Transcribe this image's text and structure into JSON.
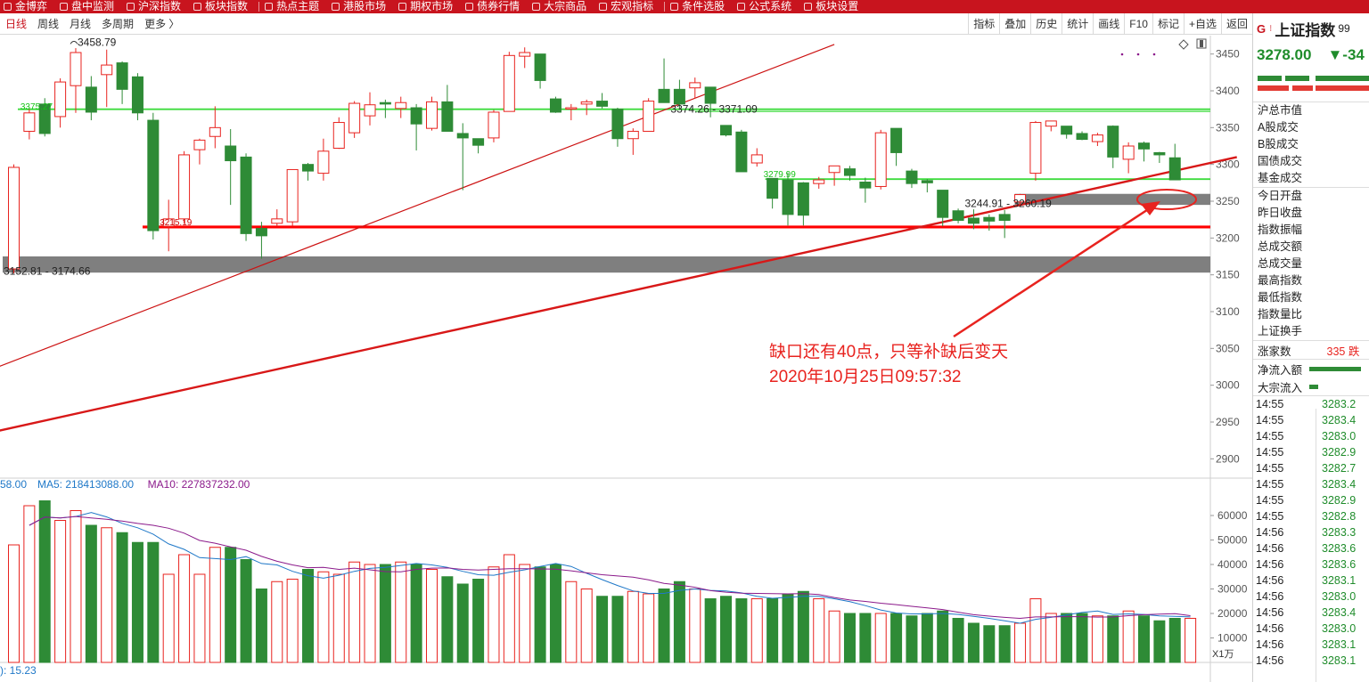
{
  "topbar": {
    "items": [
      {
        "label": "金博弈",
        "icon": "game-icon"
      },
      {
        "label": "盘中监测",
        "icon": "monitor-icon"
      },
      {
        "label": "沪深指数",
        "icon": "index-icon"
      },
      {
        "label": "板块指数",
        "icon": "sector-icon"
      },
      {
        "label": "热点主题",
        "icon": "hot-icon"
      },
      {
        "label": "港股市场",
        "icon": "hk-icon"
      },
      {
        "label": "期权市场",
        "icon": "option-icon"
      },
      {
        "label": "债券行情",
        "icon": "bond-icon"
      },
      {
        "label": "大宗商品",
        "icon": "commodity-icon"
      },
      {
        "label": "宏观指标",
        "icon": "macro-icon"
      },
      {
        "label": "条件选股",
        "icon": "filter-icon"
      },
      {
        "label": "公式系统",
        "icon": "formula-icon"
      },
      {
        "label": "板块设置",
        "icon": "settings-icon"
      }
    ]
  },
  "periods": [
    "日线",
    "周线",
    "月线",
    "多周期",
    "更多 〉"
  ],
  "tools": [
    "指标",
    "叠加",
    "历史",
    "统计",
    "画线",
    "F10",
    "标记",
    "+自选",
    "返回"
  ],
  "chart_data": {
    "type": "candlestick",
    "y_range": [
      2875,
      3475
    ],
    "y_ticks": [
      2900,
      2950,
      3000,
      3050,
      3100,
      3150,
      3200,
      3250,
      3300,
      3350,
      3400,
      3450
    ],
    "candles": [
      [
        3300,
        3152,
        3158,
        3296
      ],
      [
        3375,
        3334,
        3345,
        3370
      ],
      [
        3390,
        3338,
        3382,
        3342
      ],
      [
        3417,
        3350,
        3365,
        3412
      ],
      [
        3458,
        3370,
        3407,
        3452
      ],
      [
        3420,
        3360,
        3405,
        3371
      ],
      [
        3456,
        3378,
        3422,
        3435
      ],
      [
        3440,
        3382,
        3438,
        3402
      ],
      [
        3424,
        3360,
        3419,
        3370
      ],
      [
        3370,
        3198,
        3360,
        3210
      ],
      [
        3252,
        3182,
        3216,
        3226
      ],
      [
        3318,
        3220,
        3226,
        3313
      ],
      [
        3335,
        3300,
        3320,
        3333
      ],
      [
        3379,
        3322,
        3338,
        3350
      ],
      [
        3348,
        3245,
        3325,
        3305
      ],
      [
        3315,
        3196,
        3310,
        3206
      ],
      [
        3222,
        3172,
        3213,
        3203
      ],
      [
        3239,
        3216,
        3220,
        3226
      ],
      [
        3290,
        3216,
        3222,
        3293
      ],
      [
        3302,
        3278,
        3300,
        3291
      ],
      [
        3335,
        3278,
        3288,
        3318
      ],
      [
        3364,
        3321,
        3322,
        3357
      ],
      [
        3386,
        3336,
        3343,
        3383
      ],
      [
        3398,
        3353,
        3366,
        3381
      ],
      [
        3388,
        3363,
        3384,
        3382
      ],
      [
        3392,
        3363,
        3376,
        3384
      ],
      [
        3382,
        3319,
        3377,
        3355
      ],
      [
        3392,
        3346,
        3349,
        3385
      ],
      [
        3408,
        3345,
        3385,
        3345
      ],
      [
        3356,
        3265,
        3342,
        3336
      ],
      [
        3335,
        3315,
        3335,
        3326
      ],
      [
        3374,
        3330,
        3336,
        3371
      ],
      [
        3453,
        3372,
        3372,
        3448
      ],
      [
        3459,
        3431,
        3447,
        3452
      ],
      [
        3448,
        3403,
        3450,
        3414
      ],
      [
        3392,
        3370,
        3389,
        3371
      ],
      [
        3382,
        3360,
        3376,
        3377
      ],
      [
        3388,
        3367,
        3382,
        3385
      ],
      [
        3397,
        3376,
        3386,
        3379
      ],
      [
        3377,
        3324,
        3375,
        3335
      ],
      [
        3349,
        3313,
        3335,
        3345
      ],
      [
        3390,
        3350,
        3345,
        3386
      ],
      [
        3444,
        3385,
        3402,
        3384
      ],
      [
        3415,
        3374,
        3402,
        3382
      ],
      [
        3418,
        3390,
        3404,
        3411
      ],
      [
        3403,
        3364,
        3405,
        3383
      ],
      [
        3352,
        3338,
        3353,
        3340
      ],
      [
        3347,
        3290,
        3344,
        3290
      ],
      [
        3322,
        3297,
        3302,
        3313
      ],
      [
        3281,
        3240,
        3281,
        3254
      ],
      [
        3289,
        3217,
        3279,
        3232
      ],
      [
        3276,
        3217,
        3275,
        3231
      ],
      [
        3283,
        3267,
        3274,
        3279
      ],
      [
        3296,
        3271,
        3289,
        3298
      ],
      [
        3298,
        3278,
        3294,
        3285
      ],
      [
        3282,
        3248,
        3276,
        3268
      ],
      [
        3347,
        3266,
        3270,
        3343
      ],
      [
        3349,
        3298,
        3349,
        3316
      ],
      [
        3294,
        3268,
        3291,
        3274
      ],
      [
        3280,
        3262,
        3278,
        3275
      ],
      [
        3264,
        3216,
        3265,
        3228
      ],
      [
        3240,
        3220,
        3237,
        3224
      ],
      [
        3239,
        3212,
        3227,
        3220
      ],
      [
        3232,
        3210,
        3228,
        3223
      ],
      [
        3238,
        3200,
        3232,
        3224
      ],
      [
        3260,
        3242,
        3249,
        3259
      ],
      [
        3359,
        3278,
        3288,
        3357
      ],
      [
        3359,
        3345,
        3352,
        3359
      ],
      [
        3352,
        3335,
        3352,
        3341
      ],
      [
        3345,
        3333,
        3342,
        3334
      ],
      [
        3343,
        3325,
        3331,
        3340
      ],
      [
        3353,
        3295,
        3352,
        3310
      ],
      [
        3330,
        3288,
        3307,
        3325
      ],
      [
        3331,
        3304,
        3329,
        3321
      ],
      [
        3317,
        3302,
        3316,
        3313
      ],
      [
        3328,
        3279,
        3309,
        3279
      ]
    ],
    "labels": [
      {
        "text": "3458.79",
        "i": 4,
        "price": 3458.79,
        "color": "#222222",
        "size": 12
      },
      {
        "text": "3375.27",
        "i": 1,
        "price": 3372,
        "color": "#17c417",
        "size": 10
      },
      {
        "text": "3215.19",
        "i": 10,
        "price": 3215.19,
        "color": "#cc0000",
        "size": 10
      },
      {
        "text": "3279.99",
        "i": 49,
        "price": 3280,
        "color": "#17c417",
        "size": 10
      },
      {
        "text": "3374.26 - 3371.09",
        "i": 43,
        "price": 3368,
        "color": "#222222",
        "size": 12
      },
      {
        "text": "3244.91 - 3260.19",
        "i": 62,
        "price": 3240,
        "color": "#222222",
        "size": 12
      },
      {
        "text": "3152.81 - 3174.66",
        "i": 0,
        "price": 3148,
        "color": "#222222",
        "size": 12
      }
    ],
    "hlines": [
      {
        "price": 3375,
        "color": "#3ddc3d",
        "width": 1.8
      },
      {
        "price": 3280,
        "color": "#3ddc3d",
        "width": 1.8
      },
      {
        "price": 3215,
        "color": "#ff0000",
        "width": 3.2
      }
    ],
    "gaps": [
      {
        "low": 3153,
        "high": 3175,
        "from": -1
      },
      {
        "low": 3245,
        "high": 3260,
        "from": 65
      }
    ],
    "trendlines": [
      {
        "i1": -1,
        "p1": 3025,
        "i2": 53,
        "p2": 3463,
        "color": "#cc1111",
        "width": 1.2
      },
      {
        "i1": -1,
        "p1": 2938,
        "i2": 79,
        "p2": 3310,
        "color": "#d81818",
        "width": 2.4
      }
    ],
    "volume": {
      "legend": [
        {
          "text": "58.00",
          "color": "#1f78c8"
        },
        {
          "text": "MA5: 218413088.00",
          "color": "#1f78c8"
        },
        {
          "text": "MA10: 227837232.00",
          "color": "#8b1a8b"
        }
      ],
      "y_range": [
        0,
        68000
      ],
      "y_ticks": [
        10000,
        20000,
        30000,
        40000,
        50000,
        60000
      ],
      "unit": "X1万",
      "bars": [
        48000,
        64000,
        66000,
        58000,
        62000,
        56000,
        55000,
        53000,
        49000,
        49000,
        36000,
        44000,
        36000,
        47000,
        47000,
        42000,
        30000,
        33000,
        34000,
        38000,
        37000,
        36000,
        41000,
        40000,
        40000,
        41000,
        40000,
        38000,
        35000,
        32000,
        34000,
        39000,
        44000,
        40000,
        39000,
        40000,
        33000,
        30000,
        27000,
        27000,
        29000,
        28000,
        30000,
        33000,
        30000,
        26000,
        27000,
        26000,
        26000,
        26000,
        28000,
        29000,
        26000,
        21000,
        20000,
        20000,
        20000,
        20000,
        19000,
        20000,
        21000,
        18000,
        16000,
        15000,
        15000,
        16000,
        26000,
        20000,
        20000,
        20000,
        19000,
        19000,
        21000,
        19000,
        17000,
        18000,
        18000
      ],
      "bottom_label": "): 15.23"
    }
  },
  "annotation": {
    "line1": "缺口还有40点，只等补缺后变天",
    "line2": "2020年10月25日09:57:32"
  },
  "panel": {
    "g_icon": "G",
    "title": "上证指数",
    "code_fragment": "99",
    "price": "3278.00",
    "change": "▼-34",
    "labels1": [
      "沪总市值",
      "A股成交",
      "B股成交",
      "国债成交",
      "基金成交"
    ],
    "labels2": [
      "今日开盘",
      "昨日收盘",
      "指数振幅",
      "总成交额",
      "总成交量",
      "最高指数",
      "最低指数",
      "指数量比",
      "上证换手"
    ],
    "rise_label": "涨家数",
    "rise_value": "335 跌",
    "flow1": "净流入额",
    "flow2": "大宗流入",
    "ticks": [
      {
        "t": "14:55",
        "p": "3283.2"
      },
      {
        "t": "14:55",
        "p": "3283.4"
      },
      {
        "t": "14:55",
        "p": "3283.0"
      },
      {
        "t": "14:55",
        "p": "3282.9"
      },
      {
        "t": "14:55",
        "p": "3282.7"
      },
      {
        "t": "14:55",
        "p": "3283.4"
      },
      {
        "t": "14:55",
        "p": "3282.9"
      },
      {
        "t": "14:55",
        "p": "3282.8"
      },
      {
        "t": "14:56",
        "p": "3283.3"
      },
      {
        "t": "14:56",
        "p": "3283.6"
      },
      {
        "t": "14:56",
        "p": "3283.6"
      },
      {
        "t": "14:56",
        "p": "3283.1"
      },
      {
        "t": "14:56",
        "p": "3283.0"
      },
      {
        "t": "14:56",
        "p": "3283.4"
      },
      {
        "t": "14:56",
        "p": "3283.0"
      },
      {
        "t": "14:56",
        "p": "3283.1"
      },
      {
        "t": "14:56",
        "p": "3283.1"
      }
    ]
  },
  "colors": {
    "up": "#e8231f",
    "down": "#2e8b36",
    "brand": "#c8141e"
  }
}
